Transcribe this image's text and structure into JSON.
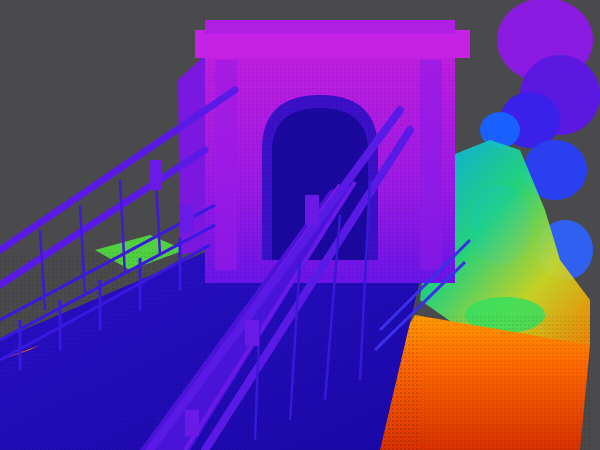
{
  "viewer": {
    "background_color": "#4a4a4c",
    "colormap": [
      "#1a00c8",
      "#3a10e0",
      "#7a18e8",
      "#b21ae6",
      "#3070ff",
      "#00c8ff",
      "#20e060",
      "#d0e020",
      "#ff8a00",
      "#e83000"
    ]
  }
}
